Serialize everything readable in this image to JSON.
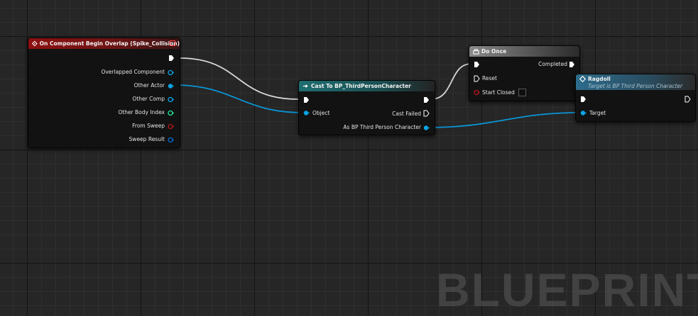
{
  "nodes": {
    "event_node": {
      "title": "On Component Begin Overlap (Spike_Collision)",
      "pins": {
        "overlapped_component": "Overlapped Component",
        "other_actor": "Other Actor",
        "other_comp": "Other Comp",
        "other_body_index": "Other Body Index",
        "from_sweep": "From Sweep",
        "sweep_result": "Sweep Result"
      }
    },
    "cast_node": {
      "title": "Cast To BP_ThirdPersonCharacter",
      "pins": {
        "object": "Object",
        "cast_failed": "Cast Failed",
        "as_bp": "As BP Third Person Character"
      }
    },
    "do_once_node": {
      "title": "Do Once",
      "pins": {
        "completed": "Completed",
        "reset": "Reset",
        "start_closed": "Start Closed"
      }
    },
    "ragdoll_node": {
      "title": "Ragdoll",
      "subtitle": "Target is BP Third Person Character",
      "pins": {
        "target": "Target"
      }
    }
  },
  "watermark": "BLUEPRINT",
  "colors": {
    "exec": "#ffffff",
    "object_pin": "#0aa4e6",
    "struct_pin": "#0a6ad8",
    "int_pin": "#1ee69a",
    "bool_pin": "#9b1a1a",
    "event_header": "#8d1010",
    "cast_header": "#1f6e71",
    "macro_header": "#8a8a8a",
    "function_header": "#2d6c8c"
  }
}
